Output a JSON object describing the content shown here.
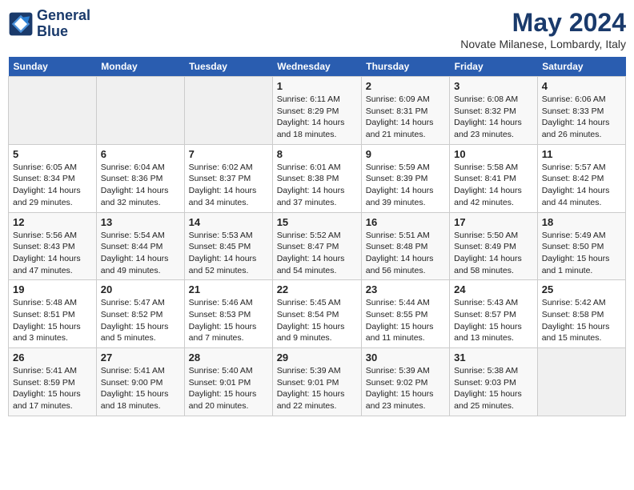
{
  "logo": {
    "line1": "General",
    "line2": "Blue"
  },
  "title": "May 2024",
  "location": "Novate Milanese, Lombardy, Italy",
  "weekdays": [
    "Sunday",
    "Monday",
    "Tuesday",
    "Wednesday",
    "Thursday",
    "Friday",
    "Saturday"
  ],
  "weeks": [
    [
      {
        "day": "",
        "info": ""
      },
      {
        "day": "",
        "info": ""
      },
      {
        "day": "",
        "info": ""
      },
      {
        "day": "1",
        "info": "Sunrise: 6:11 AM\nSunset: 8:29 PM\nDaylight: 14 hours\nand 18 minutes."
      },
      {
        "day": "2",
        "info": "Sunrise: 6:09 AM\nSunset: 8:31 PM\nDaylight: 14 hours\nand 21 minutes."
      },
      {
        "day": "3",
        "info": "Sunrise: 6:08 AM\nSunset: 8:32 PM\nDaylight: 14 hours\nand 23 minutes."
      },
      {
        "day": "4",
        "info": "Sunrise: 6:06 AM\nSunset: 8:33 PM\nDaylight: 14 hours\nand 26 minutes."
      }
    ],
    [
      {
        "day": "5",
        "info": "Sunrise: 6:05 AM\nSunset: 8:34 PM\nDaylight: 14 hours\nand 29 minutes."
      },
      {
        "day": "6",
        "info": "Sunrise: 6:04 AM\nSunset: 8:36 PM\nDaylight: 14 hours\nand 32 minutes."
      },
      {
        "day": "7",
        "info": "Sunrise: 6:02 AM\nSunset: 8:37 PM\nDaylight: 14 hours\nand 34 minutes."
      },
      {
        "day": "8",
        "info": "Sunrise: 6:01 AM\nSunset: 8:38 PM\nDaylight: 14 hours\nand 37 minutes."
      },
      {
        "day": "9",
        "info": "Sunrise: 5:59 AM\nSunset: 8:39 PM\nDaylight: 14 hours\nand 39 minutes."
      },
      {
        "day": "10",
        "info": "Sunrise: 5:58 AM\nSunset: 8:41 PM\nDaylight: 14 hours\nand 42 minutes."
      },
      {
        "day": "11",
        "info": "Sunrise: 5:57 AM\nSunset: 8:42 PM\nDaylight: 14 hours\nand 44 minutes."
      }
    ],
    [
      {
        "day": "12",
        "info": "Sunrise: 5:56 AM\nSunset: 8:43 PM\nDaylight: 14 hours\nand 47 minutes."
      },
      {
        "day": "13",
        "info": "Sunrise: 5:54 AM\nSunset: 8:44 PM\nDaylight: 14 hours\nand 49 minutes."
      },
      {
        "day": "14",
        "info": "Sunrise: 5:53 AM\nSunset: 8:45 PM\nDaylight: 14 hours\nand 52 minutes."
      },
      {
        "day": "15",
        "info": "Sunrise: 5:52 AM\nSunset: 8:47 PM\nDaylight: 14 hours\nand 54 minutes."
      },
      {
        "day": "16",
        "info": "Sunrise: 5:51 AM\nSunset: 8:48 PM\nDaylight: 14 hours\nand 56 minutes."
      },
      {
        "day": "17",
        "info": "Sunrise: 5:50 AM\nSunset: 8:49 PM\nDaylight: 14 hours\nand 58 minutes."
      },
      {
        "day": "18",
        "info": "Sunrise: 5:49 AM\nSunset: 8:50 PM\nDaylight: 15 hours\nand 1 minute."
      }
    ],
    [
      {
        "day": "19",
        "info": "Sunrise: 5:48 AM\nSunset: 8:51 PM\nDaylight: 15 hours\nand 3 minutes."
      },
      {
        "day": "20",
        "info": "Sunrise: 5:47 AM\nSunset: 8:52 PM\nDaylight: 15 hours\nand 5 minutes."
      },
      {
        "day": "21",
        "info": "Sunrise: 5:46 AM\nSunset: 8:53 PM\nDaylight: 15 hours\nand 7 minutes."
      },
      {
        "day": "22",
        "info": "Sunrise: 5:45 AM\nSunset: 8:54 PM\nDaylight: 15 hours\nand 9 minutes."
      },
      {
        "day": "23",
        "info": "Sunrise: 5:44 AM\nSunset: 8:55 PM\nDaylight: 15 hours\nand 11 minutes."
      },
      {
        "day": "24",
        "info": "Sunrise: 5:43 AM\nSunset: 8:57 PM\nDaylight: 15 hours\nand 13 minutes."
      },
      {
        "day": "25",
        "info": "Sunrise: 5:42 AM\nSunset: 8:58 PM\nDaylight: 15 hours\nand 15 minutes."
      }
    ],
    [
      {
        "day": "26",
        "info": "Sunrise: 5:41 AM\nSunset: 8:59 PM\nDaylight: 15 hours\nand 17 minutes."
      },
      {
        "day": "27",
        "info": "Sunrise: 5:41 AM\nSunset: 9:00 PM\nDaylight: 15 hours\nand 18 minutes."
      },
      {
        "day": "28",
        "info": "Sunrise: 5:40 AM\nSunset: 9:01 PM\nDaylight: 15 hours\nand 20 minutes."
      },
      {
        "day": "29",
        "info": "Sunrise: 5:39 AM\nSunset: 9:01 PM\nDaylight: 15 hours\nand 22 minutes."
      },
      {
        "day": "30",
        "info": "Sunrise: 5:39 AM\nSunset: 9:02 PM\nDaylight: 15 hours\nand 23 minutes."
      },
      {
        "day": "31",
        "info": "Sunrise: 5:38 AM\nSunset: 9:03 PM\nDaylight: 15 hours\nand 25 minutes."
      },
      {
        "day": "",
        "info": ""
      }
    ]
  ]
}
